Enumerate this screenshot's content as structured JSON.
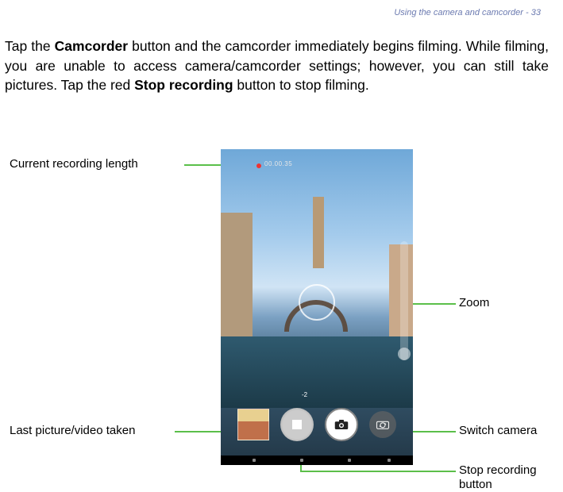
{
  "header": {
    "section_title": "Using the camera and camcorder",
    "page_number": "33",
    "separator": " - "
  },
  "paragraph": {
    "pre1": "Tap the ",
    "bold1": "Camcorder",
    "mid1": " button and the camcorder immediately begins filming. While filming, you are unable to access camera/camcorder settings; however, you can still take pictures. Tap the red ",
    "bold2": "Stop recording",
    "post2": " button to stop filming."
  },
  "callouts": {
    "recording_length": "Current recording length",
    "zoom": "Zoom",
    "last_taken": "Last picture/video taken",
    "switch_camera": "Switch camera",
    "stop_button_l1": "Stop recording",
    "stop_button_l2": "button"
  },
  "screen": {
    "rec_time": "00.00.35",
    "ev": "-2"
  }
}
